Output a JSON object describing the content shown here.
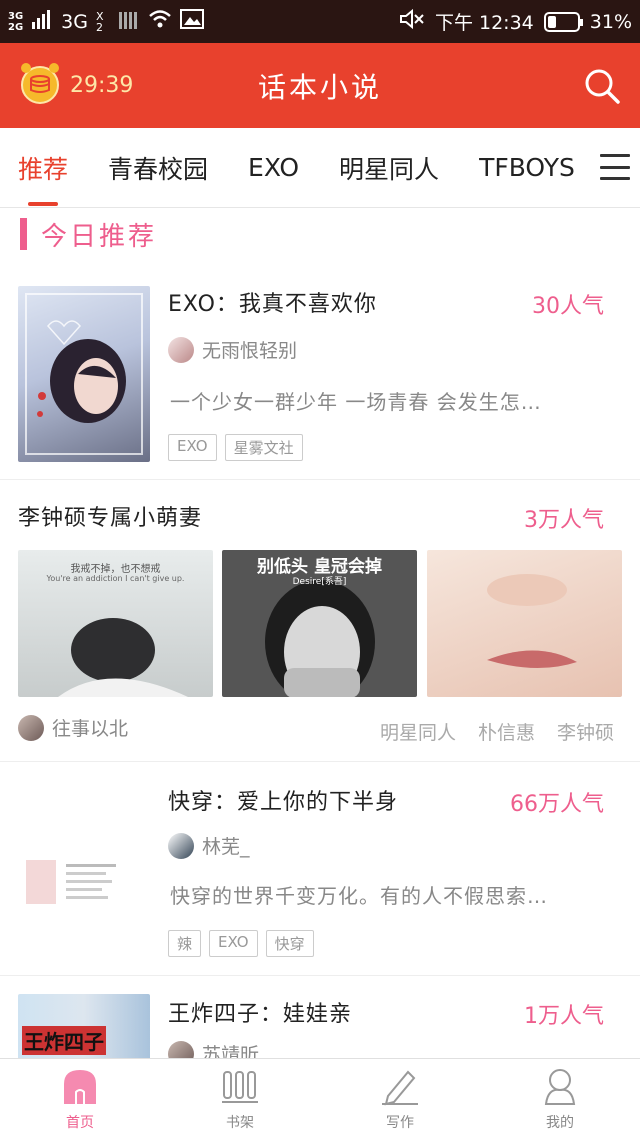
{
  "status_bar": {
    "signal_1": "3G",
    "signal_2": "2G",
    "network": "3G",
    "sim": "X 2",
    "time": "下午 12:34",
    "battery": "31%",
    "battery_level": 0.31
  },
  "header": {
    "timer": "29:39",
    "title": "话本小说",
    "accent": "#e8412d"
  },
  "tabs": [
    {
      "label": "推荐",
      "active": true
    },
    {
      "label": "青春校园",
      "active": false
    },
    {
      "label": "EXO",
      "active": false
    },
    {
      "label": "明星同人",
      "active": false
    },
    {
      "label": "TFBOYS",
      "active": false
    }
  ],
  "section": {
    "title": "今日推荐"
  },
  "books": [
    {
      "title": "EXO：我真不喜欢你",
      "popularity": "30人气",
      "author": "无雨恨轻别",
      "desc": "一个少女一群少年 一场青春 会发生怎…",
      "tags": [
        "EXO",
        "星雾文社"
      ]
    },
    {
      "title": "李钟硕专属小萌妻",
      "popularity": "3万人气",
      "author": "往事以北",
      "cover_captions": [
        "我戒不掉，也不想戒",
        "You're an addiction I can't give up.",
        "别低头 皇冠会掉",
        "Desire[系吾]"
      ],
      "tags": [
        "明星同人",
        "朴信惠",
        "李钟硕"
      ]
    },
    {
      "title": "快穿：爱上你的下半身",
      "popularity": "66万人气",
      "author": "林芜_",
      "desc": "快穿的世界千变万化。有的人不假思索…",
      "tags": [
        "辣",
        "EXO",
        "快穿"
      ]
    },
    {
      "title": "王炸四子：娃娃亲",
      "popularity": "1万人气",
      "author": "苏靖昕",
      "cover_text": "王炸四子"
    }
  ],
  "bottom_nav": [
    {
      "label": "首页",
      "icon": "home-icon",
      "active": true
    },
    {
      "label": "书架",
      "icon": "bookshelf-icon",
      "active": false
    },
    {
      "label": "写作",
      "icon": "pencil-icon",
      "active": false
    },
    {
      "label": "我的",
      "icon": "profile-icon",
      "active": false
    }
  ],
  "colors": {
    "accent_red": "#e8412d",
    "pink": "#ee5e8d"
  }
}
